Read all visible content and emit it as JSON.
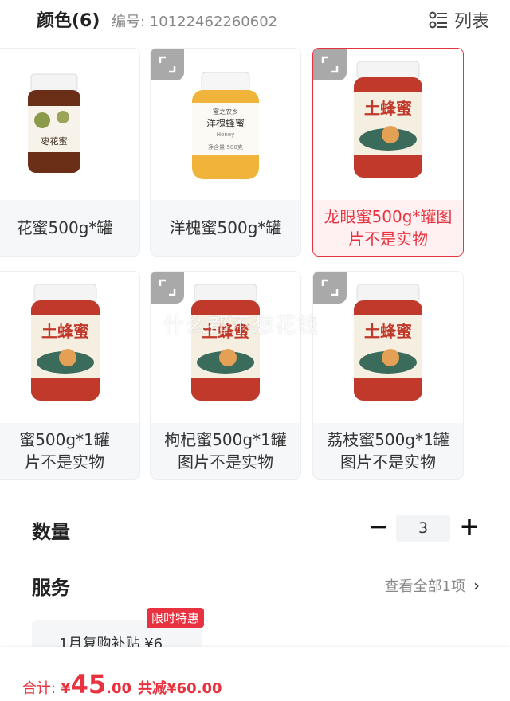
{
  "header": {
    "title": "颜色(6)",
    "code": "编号: 10122462260602",
    "view_label": "列表",
    "view_icon": "list-icon"
  },
  "products": [
    {
      "label": "花蜜500g*罐",
      "jar": "red-date",
      "selected": false
    },
    {
      "label": "洋槐蜜500g*罐",
      "jar": "acacia",
      "selected": false
    },
    {
      "label": "龙眼蜜500g*罐图\n片不是实物",
      "jar": "earth",
      "selected": true
    },
    {
      "label": "蜜500g*1罐\n片不是实物",
      "jar": "earth",
      "selected": false
    },
    {
      "label": "枸杞蜜500g*1罐\n图片不是实物",
      "jar": "earth",
      "selected": false
    },
    {
      "label": "荔枝蜜500g*1罐\n图片不是实物",
      "jar": "earth",
      "selected": false
    }
  ],
  "jar_texts": {
    "red_date": "枣花蜜",
    "acacia_brand": "蜜之农乡",
    "acacia": "洋槐蜂蜜",
    "acacia_sub": "Honey",
    "acacia_weight": "净含量:500克",
    "earth": "土蜂蜜"
  },
  "watermark": "什么都不想花钱",
  "quantity": {
    "label": "数量",
    "value": "3",
    "minus": "−",
    "plus": "+"
  },
  "service": {
    "label": "服务",
    "link": "查看全部1项",
    "chevron": "›"
  },
  "subsidy": {
    "text": "1月复购补贴  ¥6",
    "badge": "限时特惠"
  },
  "total": {
    "label": "合计:",
    "currency": "¥",
    "integer": "45",
    "decimal": ".00",
    "discount": "共减¥60.00"
  },
  "colors": {
    "accent": "#e8323f",
    "honey_red": "#c0392b",
    "honey_amber": "#f2b31e"
  }
}
